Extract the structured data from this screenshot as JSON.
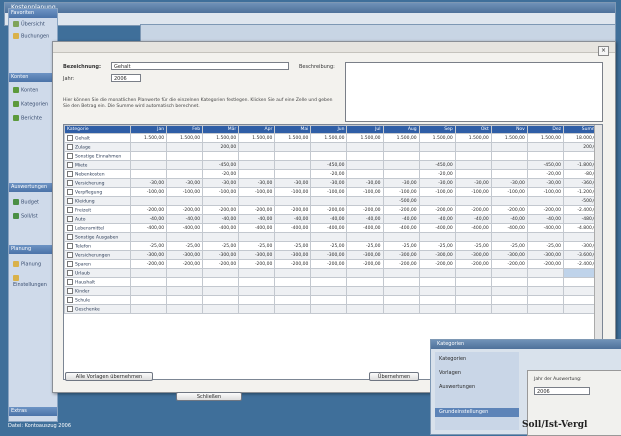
{
  "background_window": {
    "title": "Kostenplanung"
  },
  "sidebar": {
    "groups": [
      {
        "label": "Favoriten"
      },
      {
        "label": "Konten"
      },
      {
        "label": "Auswertungen"
      },
      {
        "label": "Planung"
      },
      {
        "label": "Extras"
      }
    ],
    "items": [
      {
        "label": "Übersicht"
      },
      {
        "label": "Buchungen"
      },
      {
        "label": "Konten"
      },
      {
        "label": "Kategorien"
      },
      {
        "label": "Berichte"
      },
      {
        "label": "Budget"
      },
      {
        "label": "Soll/Ist"
      },
      {
        "label": "Planung"
      },
      {
        "label": "Einstellungen"
      }
    ]
  },
  "dialog": {
    "name_label": "Bezeichnung:",
    "name_value": "Gehalt",
    "year_label": "Jahr:",
    "year_value": "2006",
    "description_label": "Beschreibung:",
    "help_text": "Hier können Sie die monatlichen Planwerte für die einzelnen Kategorien festlegen. Klicken Sie auf eine Zelle und geben Sie den Betrag ein. Die Summe wird automatisch berechnet.",
    "columns": [
      "Kategorie",
      "Jan",
      "Feb",
      "Mär",
      "Apr",
      "Mai",
      "Jun",
      "Jul",
      "Aug",
      "Sep",
      "Okt",
      "Nov",
      "Dez",
      "Summe"
    ],
    "rows": [
      [
        "Gehalt",
        "1.500,00",
        "1.500,00",
        "1.500,00",
        "1.500,00",
        "1.500,00",
        "1.500,00",
        "1.500,00",
        "1.500,00",
        "1.500,00",
        "1.500,00",
        "1.500,00",
        "1.500,00",
        "18.000,00"
      ],
      [
        "Zulage",
        "",
        "",
        "200,00",
        "",
        "",
        "",
        "",
        "",
        "",
        "",
        "",
        "",
        "200,00"
      ],
      [
        "Sonstige Einnahmen",
        "",
        "",
        "",
        "",
        "",
        "",
        "",
        "",
        "",
        "",
        "",
        "",
        ""
      ],
      [
        "Miete",
        "",
        "",
        "-450,00",
        "",
        "",
        "-450,00",
        "",
        "",
        "-450,00",
        "",
        "",
        "-450,00",
        "-1.800,00"
      ],
      [
        "Nebenkosten",
        "",
        "",
        "-20,00",
        "",
        "",
        "-20,00",
        "",
        "",
        "-20,00",
        "",
        "",
        "-20,00",
        "-80,00"
      ],
      [
        "Versicherung",
        "-30,00",
        "-30,00",
        "-30,00",
        "-30,00",
        "-30,00",
        "-30,00",
        "-30,00",
        "-30,00",
        "-30,00",
        "-30,00",
        "-30,00",
        "-30,00",
        "-360,00"
      ],
      [
        "Verpflegung",
        "-100,00",
        "-100,00",
        "-100,00",
        "-100,00",
        "-100,00",
        "-100,00",
        "-100,00",
        "-100,00",
        "-100,00",
        "-100,00",
        "-100,00",
        "-100,00",
        "-1.200,00"
      ],
      [
        "Kleidung",
        "",
        "",
        "",
        "",
        "",
        "",
        "",
        "-500,00",
        "",
        "",
        "",
        "",
        "-500,00"
      ],
      [
        "Freizeit",
        "-200,00",
        "-200,00",
        "-200,00",
        "-200,00",
        "-200,00",
        "-200,00",
        "-200,00",
        "-200,00",
        "-200,00",
        "-200,00",
        "-200,00",
        "-200,00",
        "-2.400,00"
      ],
      [
        "Auto",
        "-40,00",
        "-40,00",
        "-40,00",
        "-40,00",
        "-40,00",
        "-40,00",
        "-40,00",
        "-40,00",
        "-40,00",
        "-40,00",
        "-40,00",
        "-40,00",
        "-480,00"
      ],
      [
        "Lebensmittel",
        "-400,00",
        "-400,00",
        "-400,00",
        "-400,00",
        "-400,00",
        "-400,00",
        "-400,00",
        "-400,00",
        "-400,00",
        "-400,00",
        "-400,00",
        "-400,00",
        "-4.800,00"
      ],
      [
        "Sonstige Ausgaben",
        "",
        "",
        "",
        "",
        "",
        "",
        "",
        "",
        "",
        "",
        "",
        "",
        ""
      ],
      [
        "Telefon",
        "-25,00",
        "-25,00",
        "-25,00",
        "-25,00",
        "-25,00",
        "-25,00",
        "-25,00",
        "-25,00",
        "-25,00",
        "-25,00",
        "-25,00",
        "-25,00",
        "-300,00"
      ],
      [
        "Versicherungen",
        "-300,00",
        "-300,00",
        "-300,00",
        "-300,00",
        "-300,00",
        "-300,00",
        "-300,00",
        "-300,00",
        "-300,00",
        "-300,00",
        "-300,00",
        "-300,00",
        "-3.600,00"
      ],
      [
        "Sparen",
        "-200,00",
        "-200,00",
        "-200,00",
        "-200,00",
        "-200,00",
        "-200,00",
        "-200,00",
        "-200,00",
        "-200,00",
        "-200,00",
        "-200,00",
        "-200,00",
        "-2.400,00"
      ],
      [
        "Urlaub",
        "",
        "",
        "",
        "",
        "",
        "",
        "",
        "",
        "",
        "",
        "",
        "",
        ""
      ],
      [
        "Haushalt",
        "",
        "",
        "",
        "",
        "",
        "",
        "",
        "",
        "",
        "",
        "",
        "",
        ""
      ],
      [
        "Kinder",
        "",
        "",
        "",
        "",
        "",
        "",
        "",
        "",
        "",
        "",
        "",
        "",
        ""
      ],
      [
        "Schule",
        "",
        "",
        "",
        "",
        "",
        "",
        "",
        "",
        "",
        "",
        "",
        "",
        ""
      ],
      [
        "Geschenke",
        "",
        "",
        "",
        "",
        "",
        "",
        "",
        "",
        "",
        "",
        "",
        "",
        ""
      ]
    ],
    "footer_left_button": "Alle Vorlagen übernehmen",
    "footer_right_button": "Übernehmen"
  },
  "bottom_button": "Schließen",
  "status_bar": "Datei: Kontoauszug 2006",
  "small_window": {
    "title": "Kategorien",
    "items": [
      {
        "label": "Kategorien"
      },
      {
        "label": "Vorlagen"
      },
      {
        "label": "Auswertungen"
      }
    ],
    "section": "Grundeinstellungen",
    "field_label": "Jahr der Auswertung:",
    "field_value": "2006"
  },
  "big_title": "Soll/Ist-Vergl"
}
